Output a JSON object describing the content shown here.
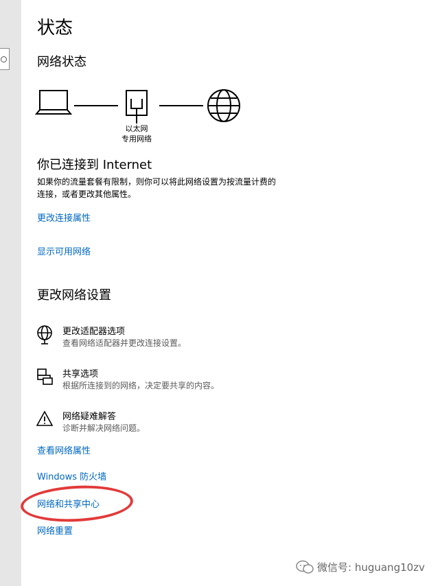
{
  "page": {
    "title": "状态"
  },
  "network_status": {
    "heading": "网络状态",
    "adapter_label_line1": "以太网",
    "adapter_label_line2": "专用网络",
    "connected_title": "你已连接到 Internet",
    "description_line1": "如果你的流量套餐有限制，则你可以将此网络设置为按流量计费的",
    "description_line2": "连接，或者更改其他属性。",
    "link_change_properties": "更改连接属性",
    "link_show_networks": "显示可用网络"
  },
  "change_settings": {
    "heading": "更改网络设置",
    "options": [
      {
        "icon": "globe-adapter-icon",
        "title": "更改适配器选项",
        "subtitle": "查看网络适配器并更改连接设置。"
      },
      {
        "icon": "sharing-icon",
        "title": "共享选项",
        "subtitle": "根据所连接到的网络，决定要共享的内容。"
      },
      {
        "icon": "warning-icon",
        "title": "网络疑难解答",
        "subtitle": "诊断并解决网络问题。"
      }
    ]
  },
  "links": {
    "view_properties": "查看网络属性",
    "firewall": "Windows 防火墙",
    "sharing_center": "网络和共享中心",
    "reset": "网络重置"
  },
  "watermark": {
    "text": "微信号: huguang10zv"
  },
  "colors": {
    "link": "#0067c0",
    "highlight": "#e23a3a",
    "sidebar": "#e6e6e6"
  }
}
